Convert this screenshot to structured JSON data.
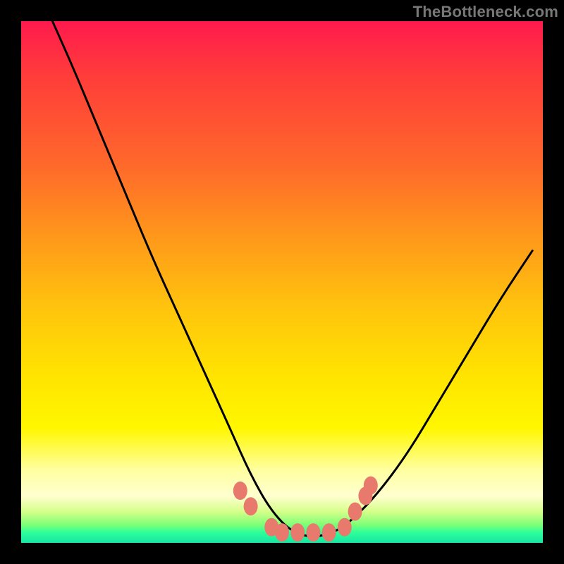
{
  "watermark": {
    "text": "TheBottleneck.com"
  },
  "chart_data": {
    "type": "line",
    "title": "",
    "xlabel": "",
    "ylabel": "",
    "xlim": [
      0,
      100
    ],
    "ylim": [
      0,
      100
    ],
    "grid": false,
    "legend": false,
    "background_gradient": {
      "top_color": "#ff1a4d",
      "mid_color": "#ffe400",
      "bottom_color": "#17e6a3"
    },
    "series": [
      {
        "name": "bottleneck-curve",
        "color": "#000000",
        "x": [
          6,
          10,
          15,
          20,
          25,
          30,
          35,
          40,
          44,
          48,
          52,
          56,
          60,
          63,
          68,
          74,
          80,
          86,
          92,
          98
        ],
        "values": [
          100,
          91,
          79,
          67,
          55,
          44,
          33,
          22,
          13,
          6,
          2,
          1,
          2,
          4,
          9,
          17,
          27,
          37,
          47,
          56
        ]
      }
    ],
    "markers": [
      {
        "x": 42,
        "y": 10,
        "color": "#e87a6d"
      },
      {
        "x": 44,
        "y": 7,
        "color": "#e87a6d"
      },
      {
        "x": 48,
        "y": 3,
        "color": "#e87a6d"
      },
      {
        "x": 50,
        "y": 2,
        "color": "#e87a6d"
      },
      {
        "x": 53,
        "y": 2,
        "color": "#e87a6d"
      },
      {
        "x": 56,
        "y": 2,
        "color": "#e87a6d"
      },
      {
        "x": 59,
        "y": 2,
        "color": "#e87a6d"
      },
      {
        "x": 62,
        "y": 3,
        "color": "#e87a6d"
      },
      {
        "x": 64,
        "y": 6,
        "color": "#e87a6d"
      },
      {
        "x": 66,
        "y": 9,
        "color": "#e87a6d"
      },
      {
        "x": 67,
        "y": 11,
        "color": "#e87a6d"
      }
    ]
  }
}
